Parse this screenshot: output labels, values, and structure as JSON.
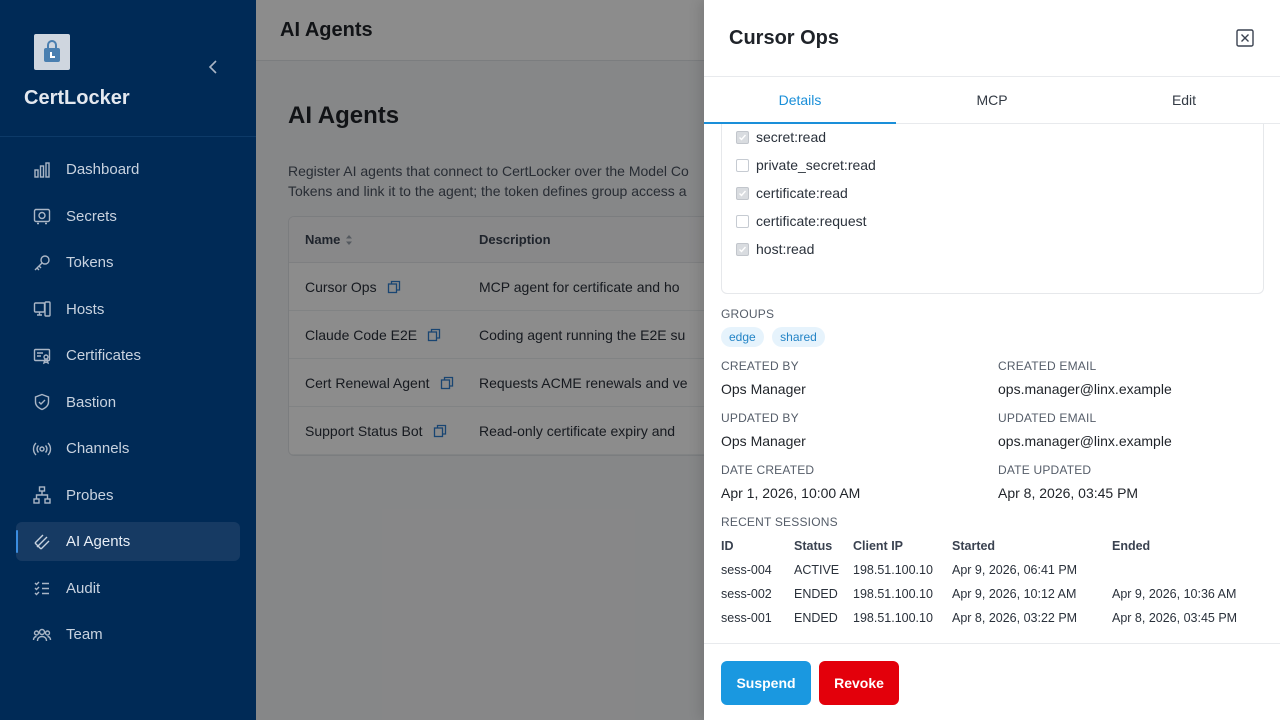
{
  "app": {
    "brand": "CertLocker"
  },
  "sidebar": {
    "items": [
      {
        "label": "Dashboard",
        "icon": "bar-chart-icon"
      },
      {
        "label": "Secrets",
        "icon": "vault-icon"
      },
      {
        "label": "Tokens",
        "icon": "key-icon"
      },
      {
        "label": "Hosts",
        "icon": "server-icon"
      },
      {
        "label": "Certificates",
        "icon": "certificate-icon"
      },
      {
        "label": "Bastion",
        "icon": "shield-icon"
      },
      {
        "label": "Channels",
        "icon": "broadcast-icon"
      },
      {
        "label": "Probes",
        "icon": "network-icon"
      },
      {
        "label": "AI Agents",
        "icon": "ai-agent-icon",
        "active": true
      },
      {
        "label": "Audit",
        "icon": "checklist-icon"
      },
      {
        "label": "Team",
        "icon": "team-icon"
      }
    ]
  },
  "topbar": {
    "title": "AI Agents"
  },
  "page": {
    "title": "AI Agents",
    "description_line1": "Register AI agents that connect to CertLocker over the Model Co",
    "description_line2": "Tokens and link it to the agent; the token defines group access a"
  },
  "table": {
    "headers": {
      "name": "Name",
      "description": "Description"
    },
    "rows": [
      {
        "name": "Cursor Ops",
        "description": "MCP agent for certificate and ho"
      },
      {
        "name": "Claude Code E2E",
        "description": "Coding agent running the E2E su"
      },
      {
        "name": "Cert Renewal Agent",
        "description": "Requests ACME renewals and ve"
      },
      {
        "name": "Support Status Bot",
        "description": "Read-only certificate expiry and"
      }
    ]
  },
  "drawer": {
    "title": "Cursor Ops",
    "tabs": [
      {
        "label": "Details",
        "active": true
      },
      {
        "label": "MCP"
      },
      {
        "label": "Edit"
      }
    ],
    "permissions": [
      {
        "label": "secret:read",
        "checked": true
      },
      {
        "label": "private_secret:read",
        "checked": false
      },
      {
        "label": "certificate:read",
        "checked": true
      },
      {
        "label": "certificate:request",
        "checked": false
      },
      {
        "label": "host:read",
        "checked": true
      }
    ],
    "groups_label": "GROUPS",
    "groups": [
      "edge",
      "shared"
    ],
    "created_by_label": "CREATED BY",
    "created_by": "Ops Manager",
    "created_email_label": "CREATED EMAIL",
    "created_email": "ops.manager@linx.example",
    "updated_by_label": "UPDATED BY",
    "updated_by": "Ops Manager",
    "updated_email_label": "UPDATED EMAIL",
    "updated_email": "ops.manager@linx.example",
    "date_created_label": "DATE CREATED",
    "date_created": "Apr 1, 2026, 10:00 AM",
    "date_updated_label": "DATE UPDATED",
    "date_updated": "Apr 8, 2026, 03:45 PM",
    "sessions_label": "RECENT SESSIONS",
    "sessions_headers": {
      "id": "ID",
      "status": "Status",
      "client_ip": "Client IP",
      "started": "Started",
      "ended": "Ended"
    },
    "sessions": [
      {
        "id": "sess-004",
        "status": "ACTIVE",
        "client_ip": "198.51.100.10",
        "started": "Apr 9, 2026, 06:41 PM",
        "ended": ""
      },
      {
        "id": "sess-002",
        "status": "ENDED",
        "client_ip": "198.51.100.10",
        "started": "Apr 9, 2026, 10:12 AM",
        "ended": "Apr 9, 2026, 10:36 AM"
      },
      {
        "id": "sess-001",
        "status": "ENDED",
        "client_ip": "198.51.100.10",
        "started": "Apr 8, 2026, 03:22 PM",
        "ended": "Apr 8, 2026, 03:45 PM"
      }
    ],
    "suspend_label": "Suspend",
    "revoke_label": "Revoke"
  },
  "colors": {
    "sidebar": "#002a56",
    "accent": "#1a98e0",
    "danger": "#e3000b"
  }
}
